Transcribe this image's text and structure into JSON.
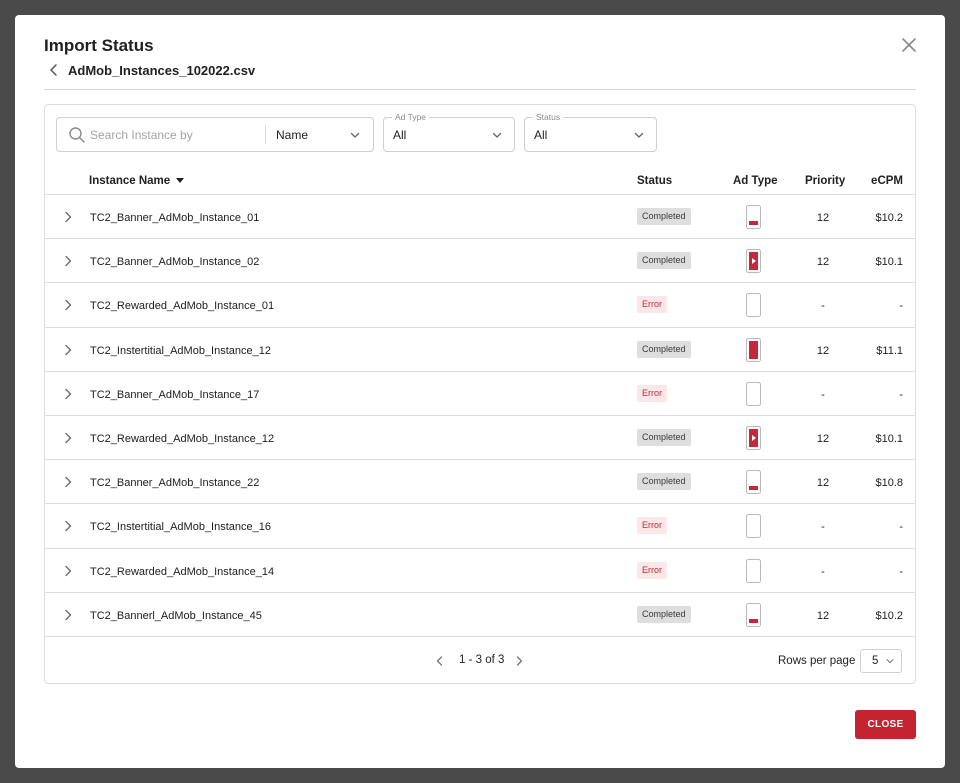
{
  "modal": {
    "title": "Import Status",
    "filename": "AdMob_Instances_102022.csv",
    "close_label": "CLOSE"
  },
  "filters": {
    "search_placeholder": "Search Instance by",
    "search_by": "Name",
    "ad_type": {
      "label": "Ad Type",
      "value": "All"
    },
    "status": {
      "label": "Status",
      "value": "All"
    }
  },
  "table": {
    "headers": {
      "instance_name": "Instance Name",
      "status": "Status",
      "ad_type": "Ad Type",
      "priority": "Priority",
      "ecpm": "eCPM"
    },
    "rows": [
      {
        "name": "TC2_Banner_AdMob_Instance_01",
        "status": "Completed",
        "ad_type": "banner",
        "priority": "12",
        "ecpm": "$10.2"
      },
      {
        "name": "TC2_Banner_AdMob_Instance_02",
        "status": "Completed",
        "ad_type": "rewarded",
        "priority": "12",
        "ecpm": "$10.1"
      },
      {
        "name": "TC2_Rewarded_AdMob_Instance_01",
        "status": "Error",
        "ad_type": "empty",
        "priority": "-",
        "ecpm": "-"
      },
      {
        "name": "TC2_Instertitial_AdMob_Instance_12",
        "status": "Completed",
        "ad_type": "interstitial",
        "priority": "12",
        "ecpm": "$11.1"
      },
      {
        "name": "TC2_Banner_AdMob_Instance_17",
        "status": "Error",
        "ad_type": "empty",
        "priority": "-",
        "ecpm": "-"
      },
      {
        "name": "TC2_Rewarded_AdMob_Instance_12",
        "status": "Completed",
        "ad_type": "rewarded",
        "priority": "12",
        "ecpm": "$10.1"
      },
      {
        "name": "TC2_Banner_AdMob_Instance_22",
        "status": "Completed",
        "ad_type": "banner",
        "priority": "12",
        "ecpm": "$10.8"
      },
      {
        "name": "TC2_Instertitial_AdMob_Instance_16",
        "status": "Error",
        "ad_type": "empty",
        "priority": "-",
        "ecpm": "-"
      },
      {
        "name": "TC2_Rewarded_AdMob_Instance_14",
        "status": "Error",
        "ad_type": "empty",
        "priority": "-",
        "ecpm": "-"
      },
      {
        "name": "TC2_Bannerl_AdMob_Instance_45",
        "status": "Completed",
        "ad_type": "banner",
        "priority": "12",
        "ecpm": "$10.2"
      }
    ]
  },
  "pagination": {
    "range": "1 - 3 of 3",
    "rows_per_page_label": "Rows per page",
    "rows_per_page": "5"
  },
  "colors": {
    "accent": "#c5232f",
    "badge_completed_bg": "#dedede",
    "badge_error_bg": "#fbe7e8",
    "badge_error_text": "#c5283d"
  },
  "icons": {
    "close": "close-icon",
    "back": "chevron-left-icon",
    "search": "search-icon",
    "dropdown": "chevron-down-icon",
    "expand": "chevron-right-icon",
    "sort": "sort-down-icon"
  }
}
